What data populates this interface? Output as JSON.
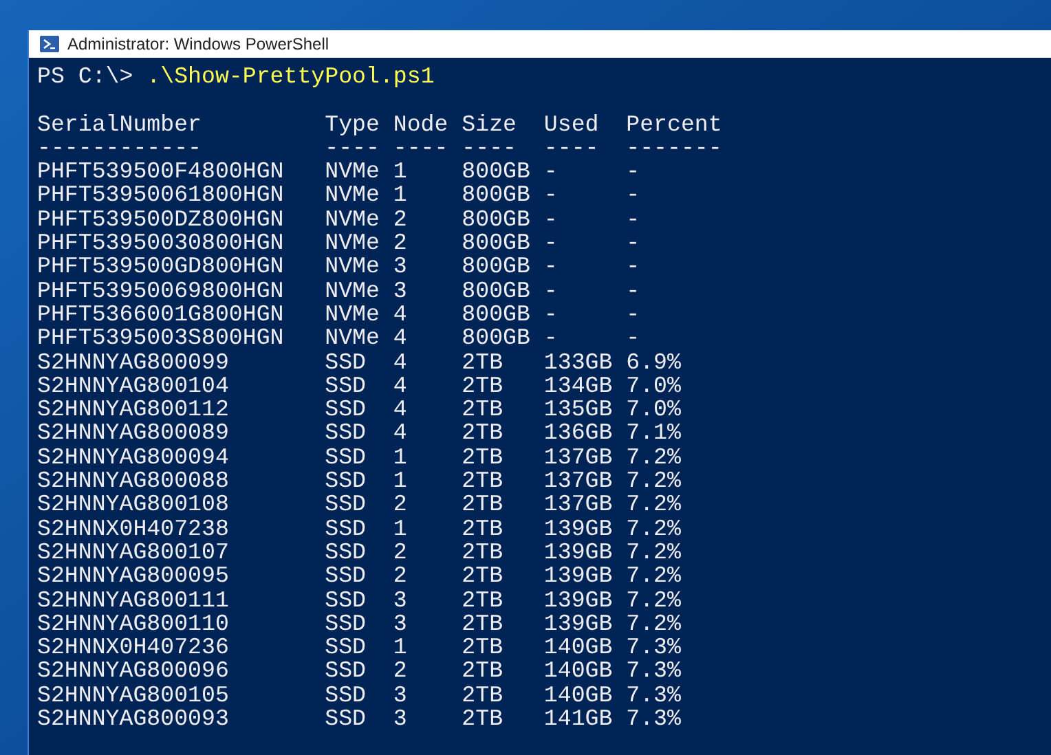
{
  "window": {
    "title": "Administrator: Windows PowerShell"
  },
  "console": {
    "prompt": "PS C:\\>",
    "command": ".\\Show-PrettyPool.ps1",
    "table": {
      "columns": [
        {
          "label": "SerialNumber",
          "rule": "------------"
        },
        {
          "label": "Type",
          "rule": "----"
        },
        {
          "label": "Node",
          "rule": "----"
        },
        {
          "label": "Size",
          "rule": "----"
        },
        {
          "label": "Used",
          "rule": "----"
        },
        {
          "label": "Percent",
          "rule": "-------"
        }
      ],
      "rows": [
        [
          "PHFT539500F4800HGN",
          "NVMe",
          "1",
          "800GB",
          "-",
          "-"
        ],
        [
          "PHFT53950061800HGN",
          "NVMe",
          "1",
          "800GB",
          "-",
          "-"
        ],
        [
          "PHFT539500DZ800HGN",
          "NVMe",
          "2",
          "800GB",
          "-",
          "-"
        ],
        [
          "PHFT53950030800HGN",
          "NVMe",
          "2",
          "800GB",
          "-",
          "-"
        ],
        [
          "PHFT539500GD800HGN",
          "NVMe",
          "3",
          "800GB",
          "-",
          "-"
        ],
        [
          "PHFT53950069800HGN",
          "NVMe",
          "3",
          "800GB",
          "-",
          "-"
        ],
        [
          "PHFT5366001G800HGN",
          "NVMe",
          "4",
          "800GB",
          "-",
          "-"
        ],
        [
          "PHFT5395003S800HGN",
          "NVMe",
          "4",
          "800GB",
          "-",
          "-"
        ],
        [
          "S2HNNYAG800099",
          "SSD",
          "4",
          "2TB",
          "133GB",
          "6.9%"
        ],
        [
          "S2HNNYAG800104",
          "SSD",
          "4",
          "2TB",
          "134GB",
          "7.0%"
        ],
        [
          "S2HNNYAG800112",
          "SSD",
          "4",
          "2TB",
          "135GB",
          "7.0%"
        ],
        [
          "S2HNNYAG800089",
          "SSD",
          "4",
          "2TB",
          "136GB",
          "7.1%"
        ],
        [
          "S2HNNYAG800094",
          "SSD",
          "1",
          "2TB",
          "137GB",
          "7.2%"
        ],
        [
          "S2HNNYAG800088",
          "SSD",
          "1",
          "2TB",
          "137GB",
          "7.2%"
        ],
        [
          "S2HNNYAG800108",
          "SSD",
          "2",
          "2TB",
          "137GB",
          "7.2%"
        ],
        [
          "S2HNNX0H407238",
          "SSD",
          "1",
          "2TB",
          "139GB",
          "7.2%"
        ],
        [
          "S2HNNYAG800107",
          "SSD",
          "2",
          "2TB",
          "139GB",
          "7.2%"
        ],
        [
          "S2HNNYAG800095",
          "SSD",
          "2",
          "2TB",
          "139GB",
          "7.2%"
        ],
        [
          "S2HNNYAG800111",
          "SSD",
          "3",
          "2TB",
          "139GB",
          "7.2%"
        ],
        [
          "S2HNNYAG800110",
          "SSD",
          "3",
          "2TB",
          "139GB",
          "7.2%"
        ],
        [
          "S2HNNX0H407236",
          "SSD",
          "1",
          "2TB",
          "140GB",
          "7.3%"
        ],
        [
          "S2HNNYAG800096",
          "SSD",
          "2",
          "2TB",
          "140GB",
          "7.3%"
        ],
        [
          "S2HNNYAG800105",
          "SSD",
          "3",
          "2TB",
          "140GB",
          "7.3%"
        ],
        [
          "S2HNNYAG800093",
          "SSD",
          "3",
          "2TB",
          "141GB",
          "7.3%"
        ]
      ]
    }
  }
}
